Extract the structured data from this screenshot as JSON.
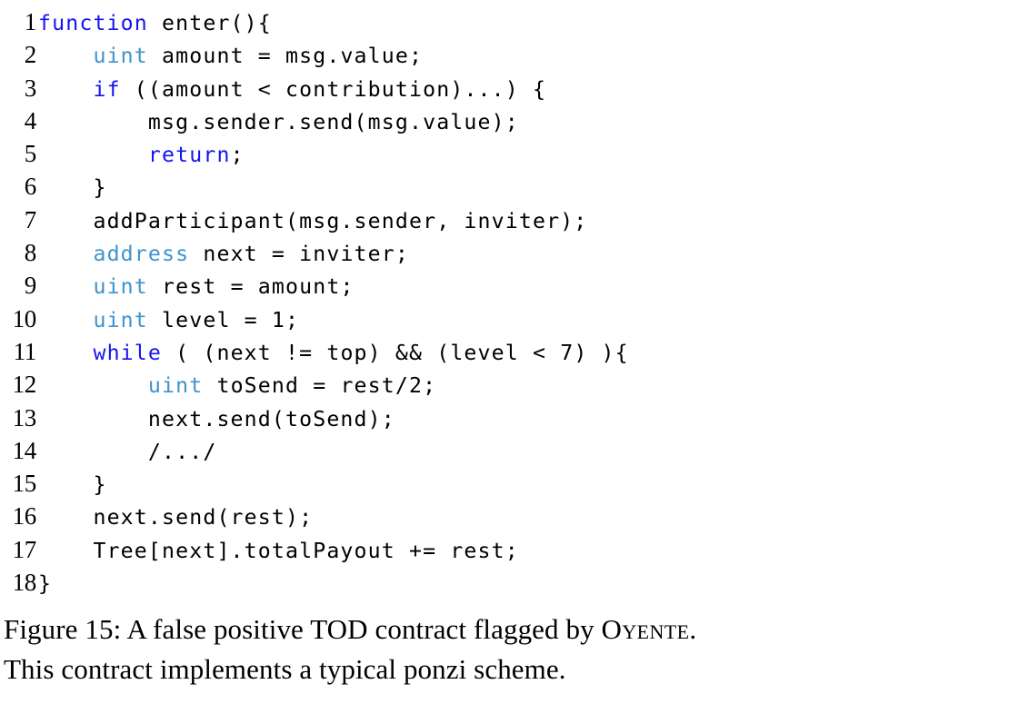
{
  "figure": {
    "caption_label": "Figure 15:",
    "caption_line1_before": " A false positive TOD contract flagged by ",
    "caption_smallcaps": "Oyente",
    "caption_line1_after": ".",
    "caption_line2": "This contract implements a typical ponzi scheme."
  },
  "colors": {
    "keyword_blue": "#1515ee",
    "type_blue": "#3f93cc",
    "text_black": "#000000",
    "background": "#ffffff"
  },
  "listing": {
    "language": "solidity",
    "lines": [
      {
        "number": "1",
        "indent": "",
        "tokens": [
          {
            "text": "function",
            "style": "kw"
          },
          {
            "text": " enter(){",
            "style": "plain"
          }
        ]
      },
      {
        "number": "2",
        "indent": "    ",
        "tokens": [
          {
            "text": "uint",
            "style": "type"
          },
          {
            "text": " amount = msg.value;",
            "style": "plain"
          }
        ]
      },
      {
        "number": "3",
        "indent": "    ",
        "tokens": [
          {
            "text": "if",
            "style": "kw"
          },
          {
            "text": " ((amount < contribution)...) {",
            "style": "plain"
          }
        ]
      },
      {
        "number": "4",
        "indent": "        ",
        "tokens": [
          {
            "text": "msg.sender.send(msg.value);",
            "style": "plain"
          }
        ]
      },
      {
        "number": "5",
        "indent": "        ",
        "tokens": [
          {
            "text": "return",
            "style": "kw"
          },
          {
            "text": ";",
            "style": "plain"
          }
        ]
      },
      {
        "number": "6",
        "indent": "    ",
        "tokens": [
          {
            "text": "}",
            "style": "plain"
          }
        ]
      },
      {
        "number": "7",
        "indent": "    ",
        "tokens": [
          {
            "text": "addParticipant(msg.sender, inviter);",
            "style": "plain"
          }
        ]
      },
      {
        "number": "8",
        "indent": "    ",
        "tokens": [
          {
            "text": "address",
            "style": "type"
          },
          {
            "text": " next = inviter;",
            "style": "plain"
          }
        ]
      },
      {
        "number": "9",
        "indent": "    ",
        "tokens": [
          {
            "text": "uint",
            "style": "type"
          },
          {
            "text": " rest = amount;",
            "style": "plain"
          }
        ]
      },
      {
        "number": "10",
        "indent": "    ",
        "tokens": [
          {
            "text": "uint",
            "style": "type"
          },
          {
            "text": " level = 1;",
            "style": "plain"
          }
        ]
      },
      {
        "number": "11",
        "indent": "    ",
        "tokens": [
          {
            "text": "while",
            "style": "kw"
          },
          {
            "text": " ( (next != top) && (level < 7) ){",
            "style": "plain"
          }
        ]
      },
      {
        "number": "12",
        "indent": "        ",
        "tokens": [
          {
            "text": "uint",
            "style": "type"
          },
          {
            "text": " toSend = rest/2;",
            "style": "plain"
          }
        ]
      },
      {
        "number": "13",
        "indent": "        ",
        "tokens": [
          {
            "text": "next.send(toSend);",
            "style": "plain"
          }
        ]
      },
      {
        "number": "14",
        "indent": "        ",
        "tokens": [
          {
            "text": "/.../",
            "style": "plain"
          }
        ]
      },
      {
        "number": "15",
        "indent": "    ",
        "tokens": [
          {
            "text": "}",
            "style": "plain"
          }
        ]
      },
      {
        "number": "16",
        "indent": "    ",
        "tokens": [
          {
            "text": "next.send(rest);",
            "style": "plain"
          }
        ]
      },
      {
        "number": "17",
        "indent": "    ",
        "tokens": [
          {
            "text": "Tree[next].totalPayout += rest;",
            "style": "plain"
          }
        ]
      },
      {
        "number": "18",
        "indent": "",
        "tokens": [
          {
            "text": "}",
            "style": "plain"
          }
        ]
      }
    ]
  }
}
